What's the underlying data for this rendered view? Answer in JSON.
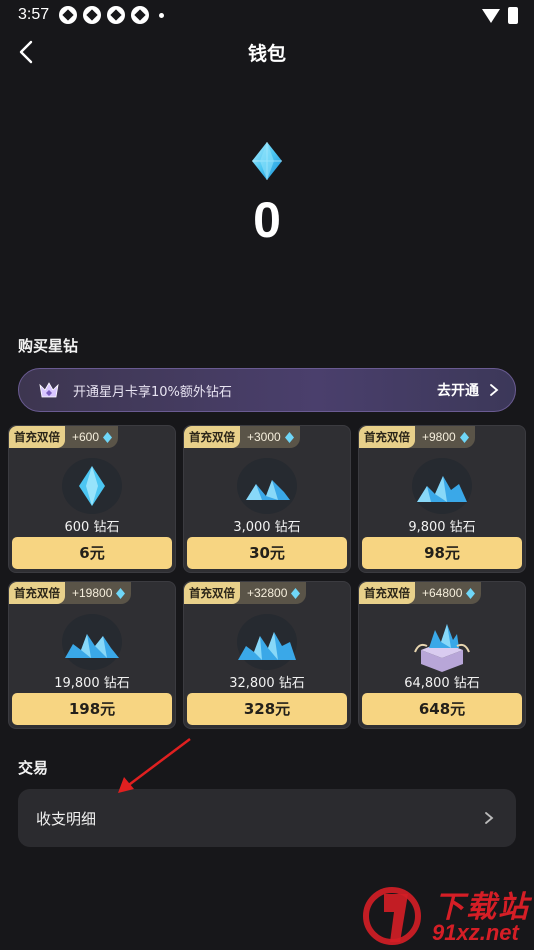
{
  "status_bar": {
    "time": "3:57"
  },
  "header": {
    "title": "钱包"
  },
  "balance": {
    "value": "0"
  },
  "purchase": {
    "title": "购买星钻",
    "vip_banner": {
      "text": "开通星月卡享10%额外钻石",
      "action": "去开通"
    },
    "packs": [
      {
        "badge": "首充双倍",
        "bonus": "+600",
        "amount": "600 钻石",
        "price": "6元"
      },
      {
        "badge": "首充双倍",
        "bonus": "+3000",
        "amount": "3,000 钻石",
        "price": "30元"
      },
      {
        "badge": "首充双倍",
        "bonus": "+9800",
        "amount": "9,800 钻石",
        "price": "98元"
      },
      {
        "badge": "首充双倍",
        "bonus": "+19800",
        "amount": "19,800 钻石",
        "price": "198元"
      },
      {
        "badge": "首充双倍",
        "bonus": "+32800",
        "amount": "32,800 钻石",
        "price": "328元"
      },
      {
        "badge": "首充双倍",
        "bonus": "+64800",
        "amount": "64,800 钻石",
        "price": "648元"
      }
    ]
  },
  "transactions": {
    "title": "交易",
    "records_label": "收支明细"
  },
  "watermark": {
    "top": "下载站",
    "bottom": "91xz.net"
  },
  "colors": {
    "background": "#17171a",
    "card": "#2f2f33",
    "price_button": "#f7d582",
    "badge": "#e8d08a",
    "diamond": "#5bd0f5",
    "annotation": "#e02020"
  },
  "icons": {
    "back": "back-arrow-icon",
    "balance": "diamond-icon",
    "vip": "crown-icon",
    "chevron": "chevron-right-icon"
  }
}
